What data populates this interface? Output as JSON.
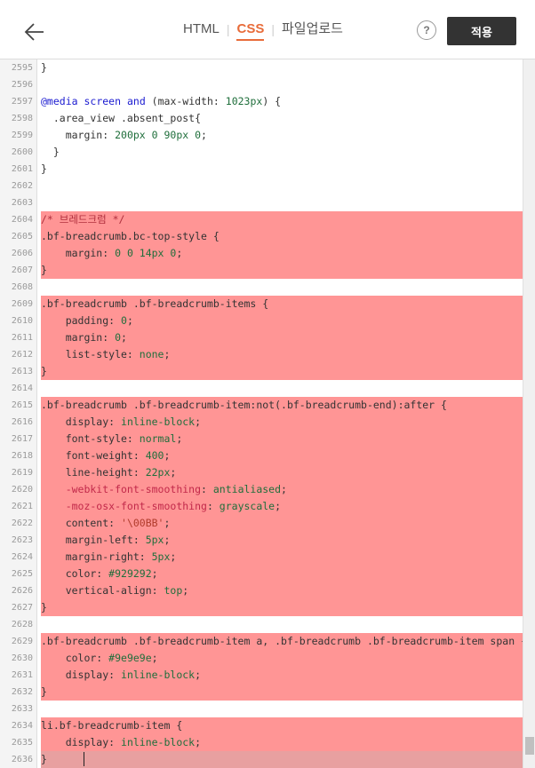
{
  "header": {
    "tabs": [
      {
        "label": "HTML",
        "active": false
      },
      {
        "label": "CSS",
        "active": true
      },
      {
        "label": "파일업로드",
        "active": false
      }
    ],
    "help_label": "?",
    "apply_label": "적용",
    "accent_color": "#e86c3a"
  },
  "editor": {
    "highlight_color": "#ff9595",
    "lines": [
      {
        "n": "2595",
        "hl": false,
        "parts": [
          [
            "c-sel",
            "}"
          ]
        ]
      },
      {
        "n": "2596",
        "hl": false,
        "parts": []
      },
      {
        "n": "2597",
        "hl": false,
        "parts": [
          [
            "c-kw",
            "@media"
          ],
          [
            "c-sel",
            " "
          ],
          [
            "c-kw",
            "screen"
          ],
          [
            "c-sel",
            " "
          ],
          [
            "c-kw",
            "and"
          ],
          [
            "c-sel",
            " (max-width: "
          ],
          [
            "c-val",
            "1023px"
          ],
          [
            "c-sel",
            ") {"
          ]
        ]
      },
      {
        "n": "2598",
        "hl": false,
        "parts": [
          [
            "c-sel",
            "  .area_view .absent_post{"
          ]
        ]
      },
      {
        "n": "2599",
        "hl": false,
        "parts": [
          [
            "c-sel",
            "    margin: "
          ],
          [
            "c-val",
            "200px 0 90px 0"
          ],
          [
            "c-sel",
            ";"
          ]
        ]
      },
      {
        "n": "2600",
        "hl": false,
        "parts": [
          [
            "c-sel",
            "  }"
          ]
        ]
      },
      {
        "n": "2601",
        "hl": false,
        "parts": [
          [
            "c-sel",
            "}"
          ]
        ]
      },
      {
        "n": "2602",
        "hl": false,
        "parts": []
      },
      {
        "n": "2603",
        "hl": false,
        "parts": []
      },
      {
        "n": "2604",
        "hl": true,
        "parts": [
          [
            "c-comment",
            "/* 브레드크럼 */"
          ]
        ]
      },
      {
        "n": "2605",
        "hl": true,
        "parts": [
          [
            "c-sel",
            ".bf-breadcrumb.bc-top-style {"
          ]
        ]
      },
      {
        "n": "2606",
        "hl": true,
        "parts": [
          [
            "c-sel",
            "    margin: "
          ],
          [
            "c-val",
            "0 0 14px 0"
          ],
          [
            "c-sel",
            ";"
          ]
        ]
      },
      {
        "n": "2607",
        "hl": true,
        "parts": [
          [
            "c-sel",
            "}"
          ]
        ]
      },
      {
        "n": "2608",
        "hl": true,
        "parts": []
      },
      {
        "n": "2609",
        "hl": true,
        "parts": [
          [
            "c-sel",
            ".bf-breadcrumb .bf-breadcrumb-items {"
          ]
        ]
      },
      {
        "n": "2610",
        "hl": true,
        "parts": [
          [
            "c-sel",
            "    padding: "
          ],
          [
            "c-val",
            "0"
          ],
          [
            "c-sel",
            ";"
          ]
        ]
      },
      {
        "n": "2611",
        "hl": true,
        "parts": [
          [
            "c-sel",
            "    margin: "
          ],
          [
            "c-val",
            "0"
          ],
          [
            "c-sel",
            ";"
          ]
        ]
      },
      {
        "n": "2612",
        "hl": true,
        "parts": [
          [
            "c-sel",
            "    list-style: "
          ],
          [
            "c-val",
            "none"
          ],
          [
            "c-sel",
            ";"
          ]
        ]
      },
      {
        "n": "2613",
        "hl": true,
        "parts": [
          [
            "c-sel",
            "}"
          ]
        ]
      },
      {
        "n": "2614",
        "hl": true,
        "parts": []
      },
      {
        "n": "2615",
        "hl": true,
        "parts": [
          [
            "c-sel",
            ".bf-breadcrumb .bf-breadcrumb-item:not(.bf-breadcrumb-end):after {"
          ]
        ]
      },
      {
        "n": "2616",
        "hl": true,
        "parts": [
          [
            "c-sel",
            "    display: "
          ],
          [
            "c-val",
            "inline-block"
          ],
          [
            "c-sel",
            ";"
          ]
        ]
      },
      {
        "n": "2617",
        "hl": true,
        "parts": [
          [
            "c-sel",
            "    font-style: "
          ],
          [
            "c-val",
            "normal"
          ],
          [
            "c-sel",
            ";"
          ]
        ]
      },
      {
        "n": "2618",
        "hl": true,
        "parts": [
          [
            "c-sel",
            "    font-weight: "
          ],
          [
            "c-val",
            "400"
          ],
          [
            "c-sel",
            ";"
          ]
        ]
      },
      {
        "n": "2619",
        "hl": true,
        "parts": [
          [
            "c-sel",
            "    line-height: "
          ],
          [
            "c-val",
            "22px"
          ],
          [
            "c-sel",
            ";"
          ]
        ]
      },
      {
        "n": "2620",
        "hl": true,
        "parts": [
          [
            "c-vendor",
            "    -webkit-font-smoothing"
          ],
          [
            "c-sel",
            ": "
          ],
          [
            "c-val",
            "antialiased"
          ],
          [
            "c-sel",
            ";"
          ]
        ]
      },
      {
        "n": "2621",
        "hl": true,
        "parts": [
          [
            "c-vendor",
            "    -moz-osx-font-smoothing"
          ],
          [
            "c-sel",
            ": "
          ],
          [
            "c-val",
            "grayscale"
          ],
          [
            "c-sel",
            ";"
          ]
        ]
      },
      {
        "n": "2622",
        "hl": true,
        "parts": [
          [
            "c-sel",
            "    content: "
          ],
          [
            "c-str",
            "'\\00BB'"
          ],
          [
            "c-sel",
            ";"
          ]
        ]
      },
      {
        "n": "2623",
        "hl": true,
        "parts": [
          [
            "c-sel",
            "    margin-left: "
          ],
          [
            "c-val",
            "5px"
          ],
          [
            "c-sel",
            ";"
          ]
        ]
      },
      {
        "n": "2624",
        "hl": true,
        "parts": [
          [
            "c-sel",
            "    margin-right: "
          ],
          [
            "c-val",
            "5px"
          ],
          [
            "c-sel",
            ";"
          ]
        ]
      },
      {
        "n": "2625",
        "hl": true,
        "parts": [
          [
            "c-sel",
            "    color: "
          ],
          [
            "c-val",
            "#929292"
          ],
          [
            "c-sel",
            ";"
          ]
        ]
      },
      {
        "n": "2626",
        "hl": true,
        "parts": [
          [
            "c-sel",
            "    vertical-align: "
          ],
          [
            "c-val",
            "top"
          ],
          [
            "c-sel",
            ";"
          ]
        ]
      },
      {
        "n": "2627",
        "hl": true,
        "parts": [
          [
            "c-sel",
            "}"
          ]
        ]
      },
      {
        "n": "2628",
        "hl": true,
        "parts": []
      },
      {
        "n": "2629",
        "hl": true,
        "parts": [
          [
            "c-sel",
            ".bf-breadcrumb .bf-breadcrumb-item a, .bf-breadcrumb .bf-breadcrumb-item span {"
          ]
        ]
      },
      {
        "n": "2630",
        "hl": true,
        "parts": [
          [
            "c-sel",
            "    color: "
          ],
          [
            "c-val",
            "#9e9e9e"
          ],
          [
            "c-sel",
            ";"
          ]
        ]
      },
      {
        "n": "2631",
        "hl": true,
        "parts": [
          [
            "c-sel",
            "    display: "
          ],
          [
            "c-val",
            "inline-block"
          ],
          [
            "c-sel",
            ";"
          ]
        ]
      },
      {
        "n": "2632",
        "hl": true,
        "parts": [
          [
            "c-sel",
            "}"
          ]
        ]
      },
      {
        "n": "2633",
        "hl": true,
        "parts": []
      },
      {
        "n": "2634",
        "hl": true,
        "parts": [
          [
            "c-sel",
            "li.bf-breadcrumb-item {"
          ]
        ]
      },
      {
        "n": "2635",
        "hl": true,
        "parts": [
          [
            "c-sel",
            "    display: "
          ],
          [
            "c-val",
            "inline-block"
          ],
          [
            "c-sel",
            ";"
          ]
        ]
      },
      {
        "n": "2636",
        "hl": true,
        "cursor": true,
        "parts": [
          [
            "c-sel",
            "}"
          ]
        ]
      }
    ]
  }
}
